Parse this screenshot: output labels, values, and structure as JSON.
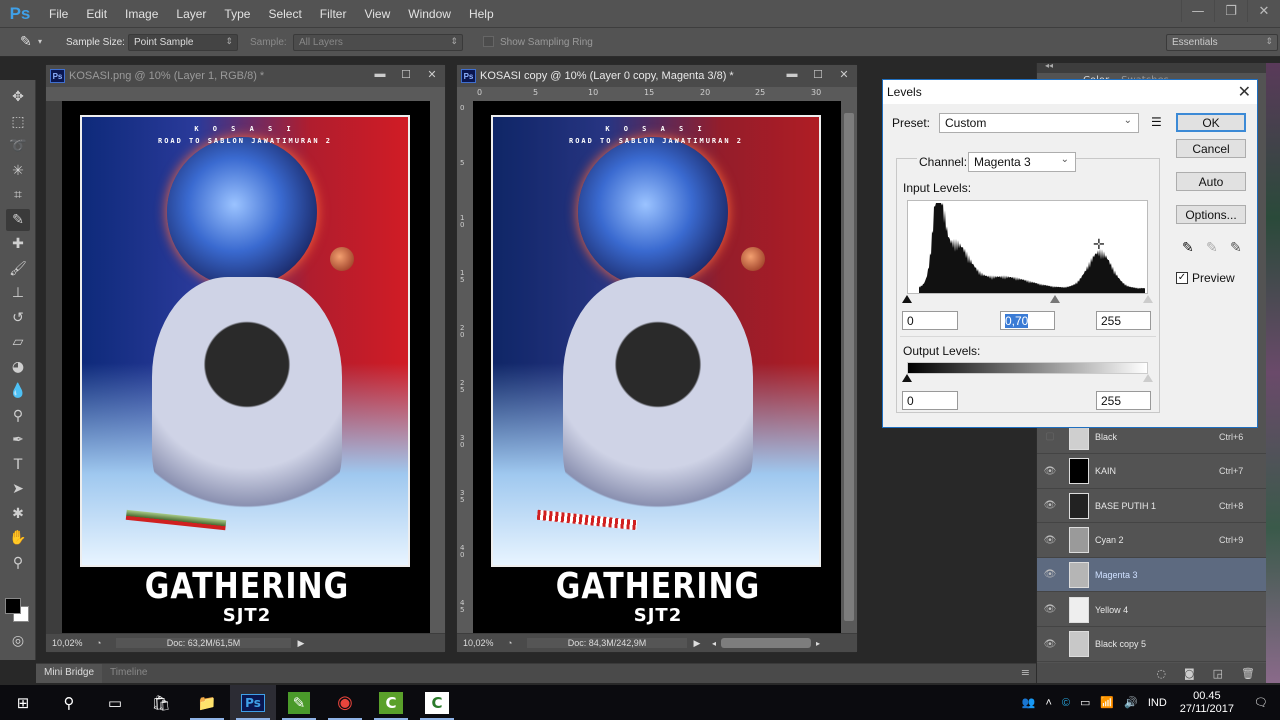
{
  "app": {
    "logo": "Ps",
    "window_controls": {
      "minimize": "—",
      "restore": "❐",
      "close": "✕"
    }
  },
  "menu": [
    "File",
    "Edit",
    "Image",
    "Layer",
    "Type",
    "Select",
    "Filter",
    "View",
    "Window",
    "Help"
  ],
  "options_bar": {
    "tool_icon": "eyedropper-icon",
    "sample_size_label": "Sample Size:",
    "sample_size_value": "Point Sample",
    "sample_label": "Sample:",
    "sample_value": "All Layers",
    "show_sampling_ring_label": "Show Sampling Ring",
    "show_sampling_ring_checked": false,
    "workspace": "Essentials"
  },
  "toolbar": {
    "tools": [
      {
        "name": "move",
        "glyph": "✥"
      },
      {
        "name": "rectangular-marquee",
        "glyph": "⬚"
      },
      {
        "name": "lasso",
        "glyph": "➰"
      },
      {
        "name": "magic-wand",
        "glyph": "✳"
      },
      {
        "name": "crop",
        "glyph": "⌗"
      },
      {
        "name": "eyedropper",
        "glyph": "✎",
        "active": true
      },
      {
        "name": "healing-brush",
        "glyph": "✚"
      },
      {
        "name": "brush",
        "glyph": "🖌"
      },
      {
        "name": "clone-stamp",
        "glyph": "⊥"
      },
      {
        "name": "history-brush",
        "glyph": "↺"
      },
      {
        "name": "eraser",
        "glyph": "▱"
      },
      {
        "name": "paint-bucket",
        "glyph": "◕"
      },
      {
        "name": "blur",
        "glyph": "💧"
      },
      {
        "name": "dodge",
        "glyph": "⚲"
      },
      {
        "name": "pen",
        "glyph": "✒"
      },
      {
        "name": "type",
        "glyph": "T"
      },
      {
        "name": "path-selection",
        "glyph": "➤"
      },
      {
        "name": "custom-shape",
        "glyph": "✱"
      },
      {
        "name": "hand",
        "glyph": "✋"
      },
      {
        "name": "zoom",
        "glyph": "⚲"
      }
    ],
    "foreground_color": "#000000",
    "background_color": "#ffffff"
  },
  "documents": [
    {
      "title": "KOSASI.png @ 10% (Layer 1, RGB/8) *",
      "active": false,
      "zoom": "10,02%",
      "doc_size": "Doc: 63,2M/61,5M"
    },
    {
      "title": "KOSASI copy @ 10% (Layer 0 copy, Magenta 3/8) *",
      "active": true,
      "zoom": "10,02%",
      "doc_size": "Doc: 84,3M/242,9M",
      "h_ruler": [
        "0",
        "5",
        "10",
        "15",
        "20",
        "25",
        "30"
      ],
      "v_ruler": [
        "0",
        "5",
        "10",
        "15",
        "20",
        "25",
        "30",
        "35",
        "40",
        "45"
      ]
    }
  ],
  "poster": {
    "line1": "K O S A S I",
    "line2": "ROAD TO SABLON JAWATIMURAN 2",
    "title": "GATHERING",
    "subtitle": "SJT2"
  },
  "bottom_panel": {
    "tabs": [
      "Mini Bridge",
      "Timeline"
    ],
    "active_tab": "Mini Bridge"
  },
  "right_panel": {
    "tabs": [
      "Color",
      "Swatches"
    ],
    "layers": [
      {
        "name": "Black",
        "shortcut": "Ctrl+6",
        "visible": false,
        "thumb": "#cfcfcf"
      },
      {
        "name": "KAIN",
        "shortcut": "Ctrl+7",
        "visible": true,
        "thumb": "#000000"
      },
      {
        "name": "BASE PUTIH 1",
        "shortcut": "Ctrl+8",
        "visible": true,
        "thumb": "#222222"
      },
      {
        "name": "Cyan 2",
        "shortcut": "Ctrl+9",
        "visible": true,
        "thumb": "#9a9a9a"
      },
      {
        "name": "Magenta 3",
        "shortcut": "",
        "visible": true,
        "selected": true,
        "thumb": "#b5b5b5"
      },
      {
        "name": "Yellow 4",
        "shortcut": "",
        "visible": true,
        "thumb": "#eeeeee"
      },
      {
        "name": "Black copy 5",
        "shortcut": "",
        "visible": true,
        "thumb": "#c8c8c8"
      }
    ],
    "footer_icons": [
      "load-selection-icon",
      "mask-icon",
      "new-channel-icon",
      "trash-icon"
    ]
  },
  "levels_dialog": {
    "title": "Levels",
    "preset_label": "Preset:",
    "preset_value": "Custom",
    "channel_label": "Channel:",
    "channel_value": "Magenta 3",
    "input_levels_label": "Input Levels:",
    "input_black": "0",
    "input_gamma": "0,70",
    "input_white": "255",
    "output_levels_label": "Output Levels:",
    "output_black": "0",
    "output_white": "255",
    "buttons": {
      "ok": "OK",
      "cancel": "Cancel",
      "auto": "Auto",
      "options": "Options..."
    },
    "preview_label": "Preview",
    "preview_checked": true,
    "input_slider_positions": {
      "black": 0,
      "gamma": 0.615,
      "white": 1
    },
    "output_slider_positions": {
      "black": 0,
      "white": 1
    }
  },
  "taskbar": {
    "apps": [
      {
        "name": "start",
        "glyph": "⊞"
      },
      {
        "name": "search",
        "glyph": "⚲"
      },
      {
        "name": "task-view",
        "glyph": "▭"
      },
      {
        "name": "store",
        "glyph": "🛍"
      },
      {
        "name": "file-explorer",
        "glyph": "📁"
      },
      {
        "name": "photoshop",
        "glyph": "Ps",
        "active": true
      },
      {
        "name": "coreldraw",
        "glyph": "✎"
      },
      {
        "name": "chrome",
        "glyph": "◉"
      },
      {
        "name": "camtasia-recorder",
        "glyph": "C"
      },
      {
        "name": "camtasia-studio",
        "glyph": "C"
      }
    ],
    "tray": {
      "language": "IND",
      "time": "00.45",
      "date": "27/11/2017"
    }
  }
}
